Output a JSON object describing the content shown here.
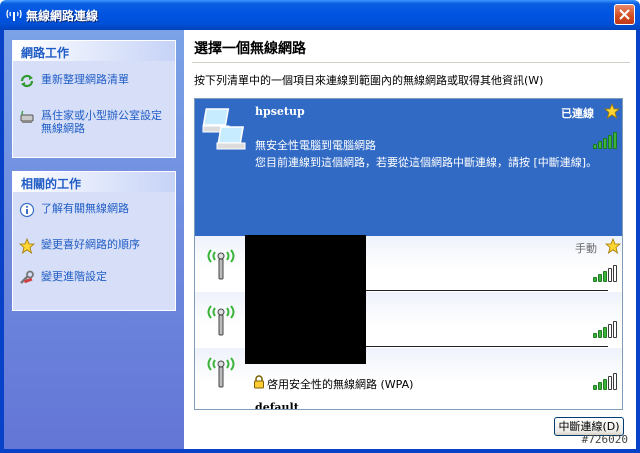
{
  "window": {
    "title": "無線網路連線"
  },
  "sidebar": {
    "network_tasks": {
      "title": "網路工作",
      "items": [
        {
          "label": "重新整理網路清單",
          "icon": "refresh-icon"
        },
        {
          "label": "爲住家或小型辦公室設定無線網路",
          "icon": "setup-wireless-icon"
        }
      ]
    },
    "related_tasks": {
      "title": "相關的工作",
      "items": [
        {
          "label": "了解有關無線網路",
          "icon": "info-icon"
        },
        {
          "label": "變更喜好網路的順序",
          "icon": "star-icon"
        },
        {
          "label": "變更進階設定",
          "icon": "settings-icon"
        }
      ]
    }
  },
  "main": {
    "title": "選擇一個無線網路",
    "description": "按下列清單中的一個項目來連線到範圍內的無線網路或取得其他資訊(W)",
    "networks": [
      {
        "name": "hpsetup",
        "status": "已連線",
        "security": "無安全性電腦到電腦網路",
        "detail": "您目前連線到這個網路，若要從這個網路中斷連線，請按 [中斷連線]。",
        "signal": 4
      },
      {
        "name": "",
        "status": "手動",
        "signal": 3
      },
      {
        "name": "",
        "status": "",
        "signal": 3
      },
      {
        "name": "",
        "status": "",
        "security": "啓用安全性的無線網路 (WPA)",
        "signal": 3
      },
      {
        "name": "default"
      }
    ],
    "disconnect_label": "中斷連線(D)"
  },
  "watermark": "#726020",
  "colors": {
    "selection": "#316ac5",
    "link": "#215dc6",
    "signal_green": "#3cb43c"
  }
}
